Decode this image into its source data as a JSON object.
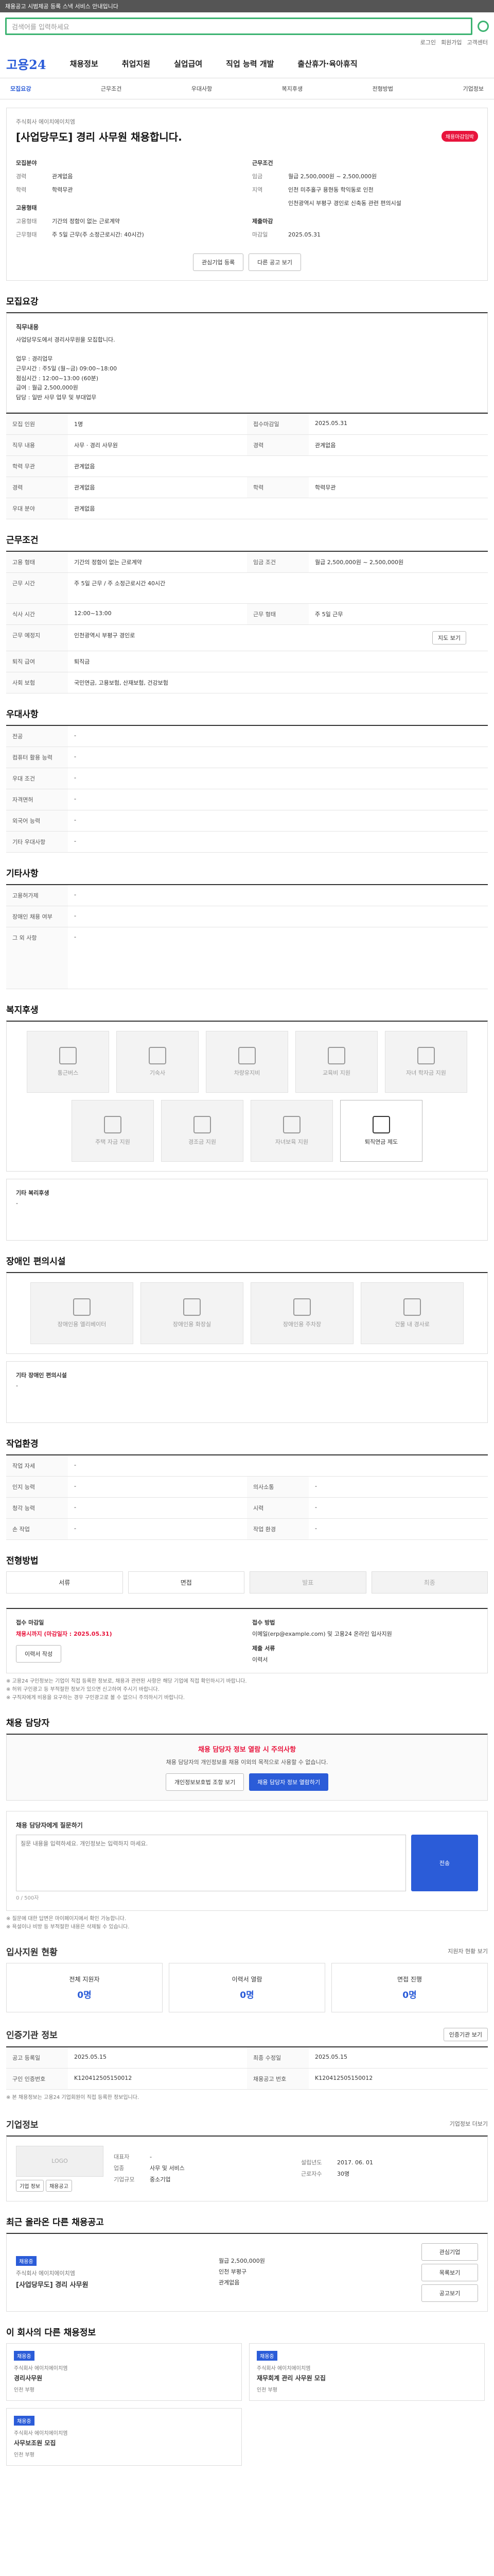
{
  "topbar": {
    "text": "채용공고 시범제공 등록 스낵 서비스 안내입니다"
  },
  "search": {
    "placeholder": "검색어를 입력하세요"
  },
  "util": [
    "로그인",
    "회원가입",
    "고객센터"
  ],
  "gnb": {
    "logo": "고용24",
    "items": [
      "채용정보",
      "취업지원",
      "실업급여",
      "직업 능력 개발",
      "출산휴가·육아휴직"
    ]
  },
  "subnav": [
    "모집요강",
    "근무조건",
    "우대사항",
    "복지후생",
    "전형방법",
    "기업정보"
  ],
  "job": {
    "company": "주식회사 에이치에이치엠",
    "title": "[사업당무도] 경리 사무원 채용합니다.",
    "badge": "채용마감임박",
    "left": [
      {
        "k": "모집분야",
        "v": ""
      },
      {
        "k": "경력",
        "v": "관계없음"
      },
      {
        "k": "학력",
        "v": "학력무관"
      },
      {
        "k": "고용형태",
        "v": ""
      },
      {
        "k": "고용형태",
        "v": "기간의 정함이 없는 근로계약"
      },
      {
        "k": "근무형태",
        "v": "주 5일 근무(주 소정근로시간: 40시간)"
      }
    ],
    "right": [
      {
        "k": "근무조건",
        "v": ""
      },
      {
        "k": "임금",
        "v": "월급 2,500,000원 ~ 2,500,000원"
      },
      {
        "k": "지역",
        "v": "인천 미추홀구 용현동 학익동로 인천"
      },
      {
        "k": "",
        "v": "인천광역시 부평구 경인로 신축동 관련 편의시설"
      },
      {
        "k": "제출마감",
        "v": ""
      },
      {
        "k": "마감일",
        "v": "2025.05.31"
      }
    ],
    "btn_interest": "관심기업 등록",
    "btn_scrap": "다른 공고 보기"
  },
  "recruit": {
    "title": "모집요강",
    "duty_title": "직무내용",
    "duty": "사업당무도에서 경리사무원을 모집합니다.\n\n업무 : 경리업무\n근무시간 : 주5일 (월~금) 09:00~18:00\n점심시간 : 12:00~13:00 (60분)\n급여 : 월급 2,500,000원\n담당 : 일반 사무 업무 및 부대업무",
    "rows": [
      [
        "모집 인원",
        "1명",
        "접수마감일",
        "2025.05.31"
      ],
      [
        "직무 내용",
        "사무 · 경리 사무원",
        "경력",
        "관계없음"
      ],
      [
        "학력 무관",
        "관계없음",
        "",
        ""
      ],
      [
        "경력",
        "관계없음",
        "학력",
        "학력무관"
      ],
      [
        "우대 분야",
        "관계없음",
        "",
        ""
      ]
    ]
  },
  "cond": {
    "title": "근무조건",
    "rows": [
      [
        "고용 형태",
        "기간의 정함이 없는 근로계약",
        "임금 조건",
        "월급 2,500,000원 ~ 2,500,000원"
      ],
      [
        "근무 시간",
        "주 5일 근무 / 주 소정근로시간 40시간",
        "",
        ""
      ],
      [
        "식사 시간",
        "12:00~13:00",
        "근무 형태",
        "주 5일 근무"
      ],
      [
        "근무 예정지",
        "인천광역시 부평구 경인로",
        "",
        ""
      ],
      [
        "퇴직 급여",
        "퇴직금",
        "",
        ""
      ],
      [
        "사회 보험",
        "국민연금, 고용보험, 산재보험, 건강보험",
        "",
        ""
      ]
    ],
    "map_btn": "지도 보기"
  },
  "pref": {
    "title": "우대사항",
    "rows": [
      [
        "전공",
        "-"
      ],
      [
        "컴퓨터 활용 능력",
        "-"
      ],
      [
        "우대 조건",
        "-"
      ],
      [
        "자격면허",
        "-"
      ],
      [
        "외국어 능력",
        "-"
      ],
      [
        "기타 우대사항",
        "-"
      ]
    ]
  },
  "other": {
    "title": "기타사항",
    "rows": [
      [
        "고용허가제",
        "-"
      ],
      [
        "장애인 채용 여부",
        "-"
      ],
      [
        "그 외 사항",
        "-"
      ]
    ]
  },
  "welfare": {
    "title": "복지후생",
    "items": [
      "통근버스",
      "기숙사",
      "차량유지비",
      "교육비 지원",
      "자녀 학자금 지원",
      "주택 자금 지원",
      "경조금 지원",
      "자녀보육 지원",
      "퇴직연금 제도"
    ],
    "on_item": "퇴직연금 제도",
    "etc_title": "기타 복리후생",
    "etc": "-"
  },
  "disabled": {
    "title": "장애인 편의시설",
    "items": [
      "장애인용 엘리베이터",
      "장애인용 화장실",
      "장애인용 주차장",
      "건물 내 경사로"
    ],
    "etc_title": "기타 장애인 편의시설",
    "etc": "-"
  },
  "env": {
    "title": "작업환경",
    "rows": [
      [
        "작업 자세",
        "-",
        "",
        ""
      ],
      [
        "인지 능력",
        "-",
        "의사소통",
        "-"
      ],
      [
        "청각 능력",
        "-",
        "시력",
        "-"
      ],
      [
        "손 작업",
        "-",
        "작업 환경",
        "-"
      ]
    ]
  },
  "process": {
    "title": "전형방법",
    "steps": [
      "서류",
      "면접",
      "발표",
      "최종"
    ]
  },
  "apply": {
    "method_title": "접수 마감일",
    "deadline": "채용시까지 (마감일자 : 2025.05.31)",
    "method": "접수 방법",
    "method_v": "이메일(erp@example.com) 및 고용24 온라인 입사지원",
    "docs": "제출 서류",
    "docs_v": "이력서",
    "btn_apply": "이력서 작성"
  },
  "notes": [
    "※ 고용24 구인정보는 기업이 직접 등록한 정보로, 채용과 관련된 사항은 해당 기업에 직접 확인하시기 바랍니다.",
    "※ 허위 구인광고 등 부적절한 정보가 있으면 신고하여 주시기 바랍니다.",
    "※ 구직자에게 비용을 요구하는 경우 구인광고로 볼 수 없으니 주의하시기 바랍니다."
  ],
  "manager": {
    "title": "채용 담당자",
    "alert": "채용 담당자 정보 열람 시 주의사항",
    "alert_text": "채용 담당자의 개인정보를 채용 이외의 목적으로 사용할 수 없습니다.",
    "btn1": "개인정보보호법 조항 보기",
    "btn2": "채용 담당자 정보 열람하기"
  },
  "qna": {
    "title": "채용 담당자에게 질문하기",
    "placeholder": "질문 내용을 입력하세요. 개인정보는 입력하지 마세요.",
    "count": "0 / 500자",
    "btn": "전송",
    "notes": [
      "※ 질문에 대한 답변은 마이페이지에서 확인 가능합니다.",
      "※ 욕설이나 비방 등 부적절한 내용은 삭제될 수 있습니다."
    ]
  },
  "applicants": {
    "title": "입사지원 현황",
    "more": "지원자 현황 보기",
    "stats": [
      {
        "k": "전체 지원자",
        "v": "0명"
      },
      {
        "k": "이력서 열람",
        "v": "0명"
      },
      {
        "k": "면접 진행",
        "v": "0명"
      }
    ]
  },
  "info": {
    "title": "인증기관 정보",
    "btn": "인증기관 보기",
    "rows": [
      [
        "공고 등록일",
        "2025.05.15",
        "최종 수정일",
        "2025.05.15"
      ],
      [
        "구인 인증번호",
        "K120412505150012",
        "채용공고 번호",
        "K120412505150012"
      ]
    ],
    "note": "※ 본 채용정보는 고용24 기업회원이 직접 등록한 정보입니다."
  },
  "company": {
    "title": "기업정보",
    "more": "기업정보 더보기",
    "logo": "LOGO",
    "name": "주식회사 에이치에이치엠",
    "ceo": "대표자",
    "ceo_v": "-",
    "industry": "업종",
    "industry_v": "사무 및 서비스",
    "size": "기업규모",
    "size_v": "중소기업",
    "found": "설립년도",
    "found_v": "2017. 06. 01",
    "emp": "근로자수",
    "emp_v": "30명",
    "btn1": "기업 정보",
    "btn2": "채용공고"
  },
  "similar": {
    "title": "최근 올라온 다른 채용공고",
    "tag": "채용중",
    "name": "주식회사 에이치에이치엠",
    "job": "[사업당무도] 경리 사무원",
    "meta": [
      "월급 2,500,000원",
      "인천 부평구",
      "관계없음"
    ],
    "b1": "관심기업",
    "b2": "목록보기",
    "b3": "공고보기"
  },
  "jobs": {
    "title": "이 회사의 다른 채용정보",
    "cards": [
      {
        "tag": "채용중",
        "co": "주식회사 에이치에이치엠",
        "title": "경리사무원",
        "m": "인천 부평"
      },
      {
        "tag": "채용중",
        "co": "주식회사 에이치에이치엠",
        "title": "재무회계 관리 사무원 모집",
        "m": "인천 부평"
      },
      {
        "tag": "채용중",
        "co": "주식회사 에이치에이치엠",
        "title": "사무보조원 모집",
        "m": "인천 부평"
      }
    ]
  }
}
